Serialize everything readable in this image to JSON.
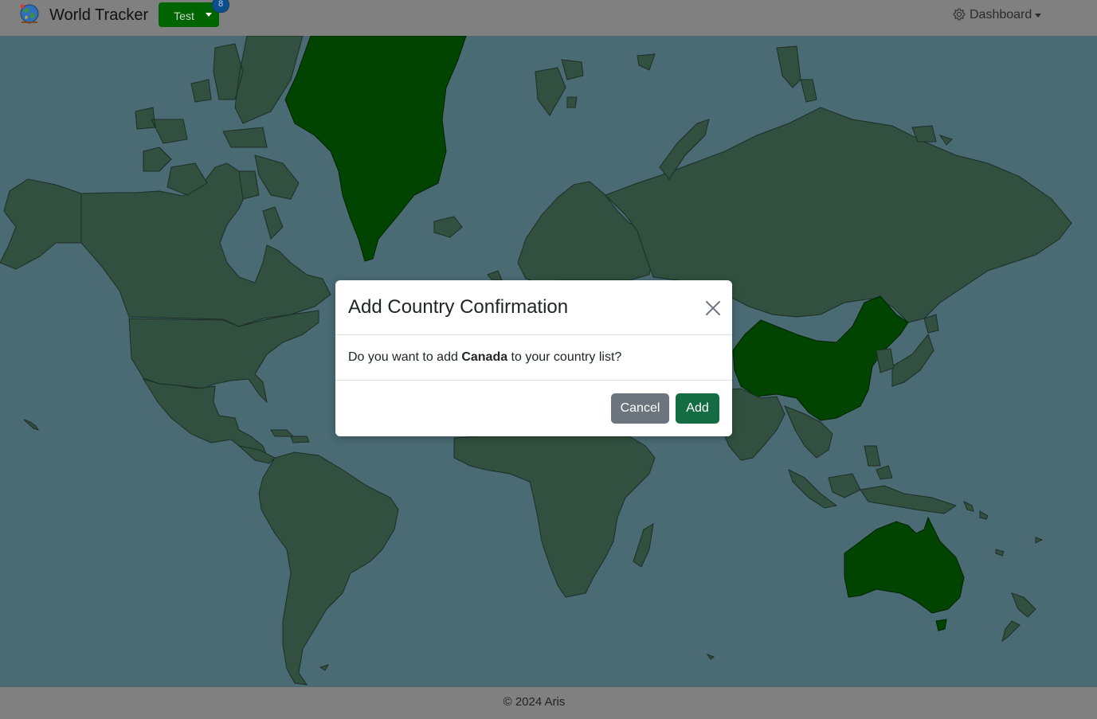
{
  "navbar": {
    "brand": "World Tracker",
    "user": {
      "name": "Test",
      "visited_count": "8"
    },
    "menu": {
      "label": "Dashboard"
    }
  },
  "map": {
    "visited_countries": [
      "Greenland",
      "China",
      "Australia"
    ],
    "colors": {
      "ocean": "#4a6b74",
      "land": "#31503f",
      "visited": "#004400"
    }
  },
  "modal": {
    "title": "Add Country Confirmation",
    "body_prefix": "Do you want to add ",
    "country": "Canada",
    "body_suffix": " to your country list?",
    "cancel_label": "Cancel",
    "confirm_label": "Add"
  },
  "footer": {
    "text": "© 2024 Aris"
  }
}
